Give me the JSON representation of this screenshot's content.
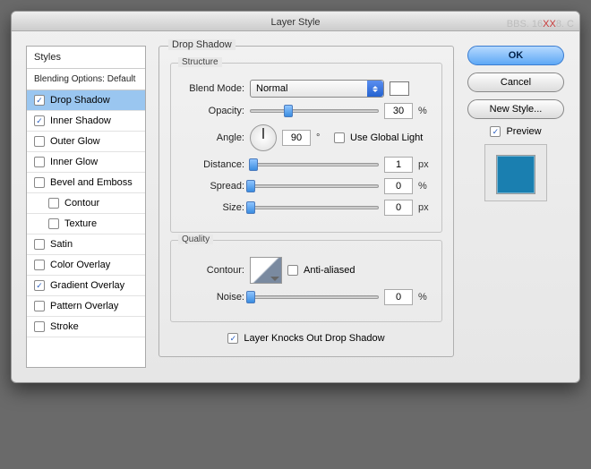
{
  "title": "Layer Style",
  "watermark": {
    "a": "BBS. 16",
    "b": "XX",
    "c": "8. C"
  },
  "sidebar": {
    "head": "Styles",
    "sub": "Blending Options: Default",
    "items": [
      {
        "label": "Drop Shadow",
        "checked": true,
        "selected": true
      },
      {
        "label": "Inner Shadow",
        "checked": true
      },
      {
        "label": "Outer Glow",
        "checked": false
      },
      {
        "label": "Inner Glow",
        "checked": false
      },
      {
        "label": "Bevel and Emboss",
        "checked": false
      },
      {
        "label": "Contour",
        "checked": false,
        "indent": true
      },
      {
        "label": "Texture",
        "checked": false,
        "indent": true
      },
      {
        "label": "Satin",
        "checked": false
      },
      {
        "label": "Color Overlay",
        "checked": false
      },
      {
        "label": "Gradient Overlay",
        "checked": true
      },
      {
        "label": "Pattern Overlay",
        "checked": false
      },
      {
        "label": "Stroke",
        "checked": false
      }
    ]
  },
  "panel": {
    "group": "Drop Shadow",
    "structure": {
      "title": "Structure",
      "blendModeLabel": "Blend Mode:",
      "blendMode": "Normal",
      "opacityLabel": "Opacity:",
      "opacity": "30",
      "opacityUnit": "%",
      "angleLabel": "Angle:",
      "angle": "90",
      "angleUnit": "°",
      "useGlobalLabel": "Use Global Light",
      "useGlobal": false,
      "distanceLabel": "Distance:",
      "distance": "1",
      "distanceUnit": "px",
      "spreadLabel": "Spread:",
      "spread": "0",
      "spreadUnit": "%",
      "sizeLabel": "Size:",
      "size": "0",
      "sizeUnit": "px"
    },
    "quality": {
      "title": "Quality",
      "contourLabel": "Contour:",
      "antiLabel": "Anti-aliased",
      "anti": false,
      "noiseLabel": "Noise:",
      "noise": "0",
      "noiseUnit": "%"
    },
    "knockLabel": "Layer Knocks Out Drop Shadow",
    "knock": true
  },
  "right": {
    "ok": "OK",
    "cancel": "Cancel",
    "newStyle": "New Style...",
    "previewLabel": "Preview",
    "preview": true
  }
}
